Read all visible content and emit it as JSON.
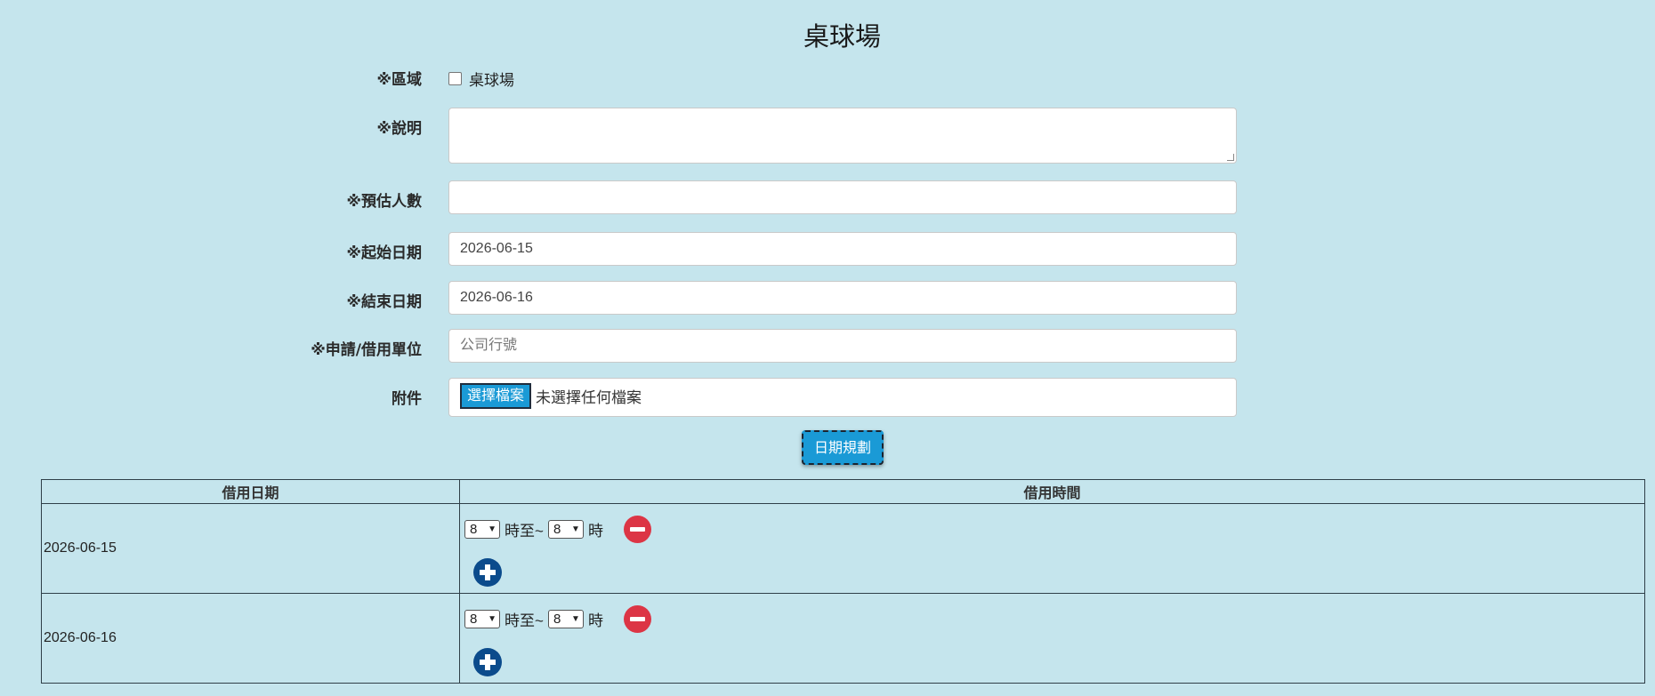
{
  "page": {
    "title": "桌球場"
  },
  "form": {
    "area": {
      "label": "※區域",
      "option": "桌球場",
      "checked": false
    },
    "description": {
      "label": "※說明",
      "value": ""
    },
    "people": {
      "label": "※預估人數",
      "value": ""
    },
    "start_date": {
      "label": "※起始日期",
      "value": "2026-06-15"
    },
    "end_date": {
      "label": "※結束日期",
      "value": "2026-06-16"
    },
    "unit": {
      "label": "※申請/借用單位",
      "placeholder": "公司行號"
    },
    "attachment": {
      "label": "附件",
      "button": "選擇檔案",
      "status": "未選擇任何檔案"
    },
    "plan_button": "日期規劃"
  },
  "schedule": {
    "headers": [
      "借用日期",
      "借用時間"
    ],
    "rows": [
      {
        "date": "2026-06-15",
        "from": "8",
        "from_suffix": "時至~",
        "to": "8",
        "to_suffix": "時"
      },
      {
        "date": "2026-06-16",
        "from": "8",
        "from_suffix": "時至~",
        "to": "8",
        "to_suffix": "時"
      }
    ]
  },
  "colors": {
    "background": "#c5e5ed",
    "primary_button": "#1a9ad6",
    "remove_icon": "#dc3545",
    "add_icon": "#0b4b8c"
  }
}
